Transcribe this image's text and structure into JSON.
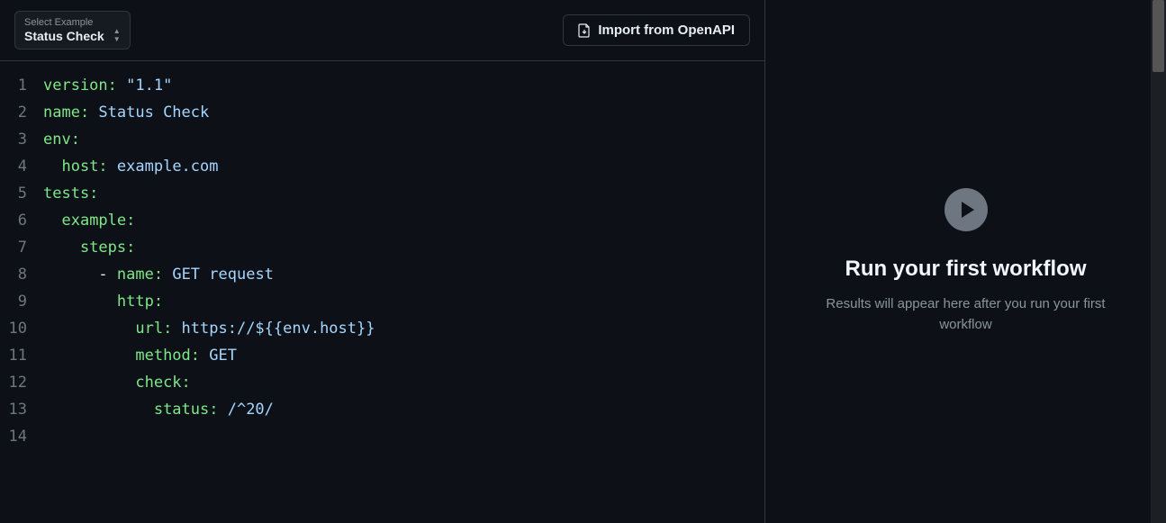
{
  "toolbar": {
    "selector_label": "Select Example",
    "selector_value": "Status Check",
    "import_label": "Import from OpenAPI"
  },
  "editor": {
    "lines": [
      {
        "n": "1",
        "tokens": [
          [
            "key",
            "version:"
          ],
          [
            "plain",
            " "
          ],
          [
            "str",
            "\"1.1\""
          ]
        ]
      },
      {
        "n": "2",
        "tokens": [
          [
            "key",
            "name:"
          ],
          [
            "plain",
            " Status Check"
          ]
        ]
      },
      {
        "n": "3",
        "tokens": [
          [
            "key",
            "env:"
          ]
        ]
      },
      {
        "n": "4",
        "tokens": [
          [
            "plain",
            "  "
          ],
          [
            "key",
            "host:"
          ],
          [
            "plain",
            " example.com"
          ]
        ]
      },
      {
        "n": "5",
        "tokens": [
          [
            "key",
            "tests:"
          ]
        ]
      },
      {
        "n": "6",
        "tokens": [
          [
            "plain",
            "  "
          ],
          [
            "key",
            "example:"
          ]
        ]
      },
      {
        "n": "7",
        "tokens": [
          [
            "plain",
            "    "
          ],
          [
            "key",
            "steps:"
          ]
        ]
      },
      {
        "n": "8",
        "tokens": [
          [
            "plain",
            "      "
          ],
          [
            "dash",
            "- "
          ],
          [
            "key",
            "name:"
          ],
          [
            "plain",
            " GET request"
          ]
        ]
      },
      {
        "n": "9",
        "tokens": [
          [
            "plain",
            "        "
          ],
          [
            "key",
            "http:"
          ]
        ]
      },
      {
        "n": "10",
        "tokens": [
          [
            "plain",
            "          "
          ],
          [
            "key",
            "url:"
          ],
          [
            "plain",
            " https://${{env.host}}"
          ]
        ]
      },
      {
        "n": "11",
        "tokens": [
          [
            "plain",
            "          "
          ],
          [
            "key",
            "method:"
          ],
          [
            "plain",
            " GET"
          ]
        ]
      },
      {
        "n": "12",
        "tokens": [
          [
            "plain",
            "          "
          ],
          [
            "key",
            "check:"
          ]
        ]
      },
      {
        "n": "13",
        "tokens": [
          [
            "plain",
            "            "
          ],
          [
            "key",
            "status:"
          ],
          [
            "plain",
            " /^20/"
          ]
        ]
      },
      {
        "n": "14",
        "tokens": []
      }
    ]
  },
  "empty_state": {
    "title": "Run your first workflow",
    "subtitle": "Results will appear here after you run your first workflow"
  }
}
